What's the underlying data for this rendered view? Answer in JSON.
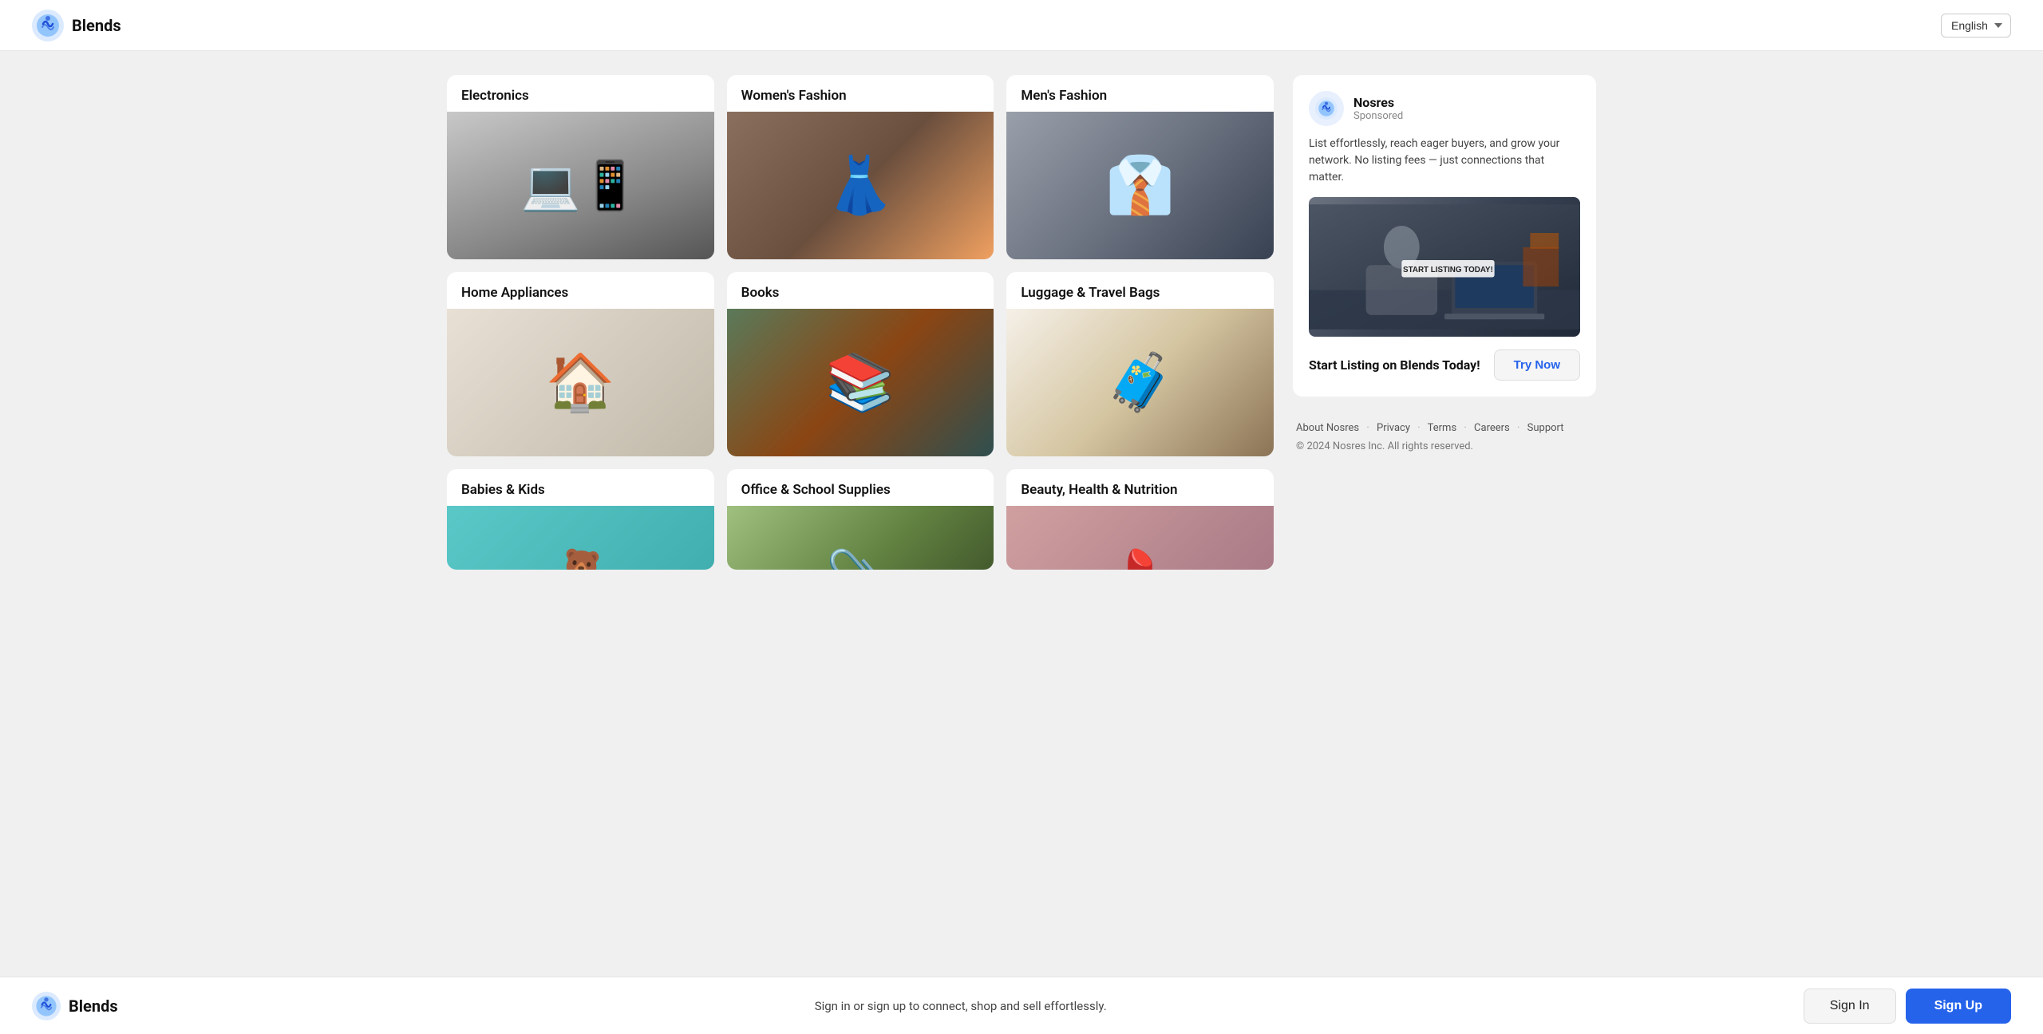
{
  "header": {
    "logo_text": "Blends",
    "lang_label": "English"
  },
  "categories": [
    {
      "id": "electronics",
      "title": "Electronics",
      "img_class": "img-electronics"
    },
    {
      "id": "womens-fashion",
      "title": "Women's Fashion",
      "img_class": "img-womens"
    },
    {
      "id": "mens-fashion",
      "title": "Men's Fashion",
      "img_class": "img-mens"
    },
    {
      "id": "home-appliances",
      "title": "Home Appliances",
      "img_class": "img-appliances"
    },
    {
      "id": "books",
      "title": "Books",
      "img_class": "img-books"
    },
    {
      "id": "luggage",
      "title": "Luggage & Travel Bags",
      "img_class": "img-luggage"
    },
    {
      "id": "babies-kids",
      "title": "Babies & Kids",
      "img_class": "img-babies",
      "partial": true
    },
    {
      "id": "office-school",
      "title": "Office & School Supplies",
      "img_class": "img-office",
      "partial": true
    },
    {
      "id": "beauty-health",
      "title": "Beauty, Health & Nutrition",
      "img_class": "img-beauty",
      "partial": true
    }
  ],
  "ad": {
    "company": "Nosres",
    "sponsored_label": "Sponsored",
    "description": "List effortlessly, reach eager buyers, and grow your network. No listing fees — just connections that matter.",
    "image_label": "START LISTING TODAY!",
    "cta_text": "Start Listing on Blends Today!",
    "try_now": "Try Now"
  },
  "footer": {
    "links": [
      "About Nosres",
      "Privacy",
      "Terms",
      "Careers",
      "Support"
    ],
    "copyright": "© 2024 Nosres Inc. All rights reserved."
  },
  "bottom_bar": {
    "logo_text": "Blends",
    "tagline": "Sign in or sign up to connect, shop and sell effortlessly.",
    "signin": "Sign In",
    "signup": "Sign Up"
  }
}
